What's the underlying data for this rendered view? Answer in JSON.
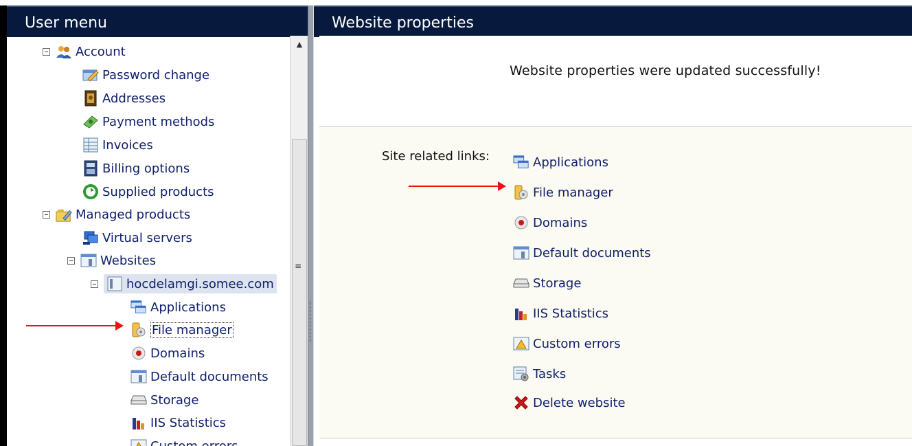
{
  "left_panel": {
    "title": "User menu",
    "account": {
      "label": "Account",
      "items": [
        "Password change",
        "Addresses",
        "Payment methods",
        "Invoices",
        "Billing options",
        "Supplied products"
      ]
    },
    "managed": {
      "label": "Managed products",
      "virtual_servers": "Virtual servers",
      "websites": "Websites",
      "site": "hocdelamgi.somee.com",
      "site_items": [
        "Applications",
        "File manager",
        "Domains",
        "Default documents",
        "Storage",
        "IIS Statistics",
        "Custom errors"
      ]
    }
  },
  "right_panel": {
    "title": "Website properties",
    "success_message": "Website properties were updated successfully!",
    "links_caption": "Site related links:",
    "links": [
      "Applications",
      "File manager",
      "Domains",
      "Default documents",
      "Storage",
      "IIS Statistics",
      "Custom errors",
      "Tasks",
      "Delete website"
    ]
  },
  "colors": {
    "header_bg": "#071a3e",
    "link_text": "#10206b",
    "annotation_arrow": "#ee1111"
  }
}
